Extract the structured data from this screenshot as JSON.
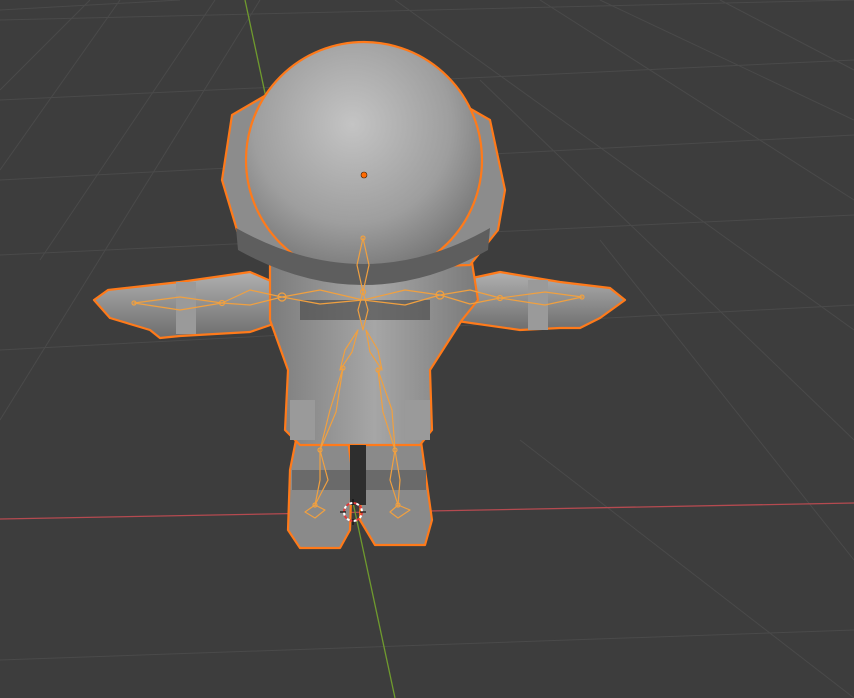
{
  "app": {
    "name": "3D viewport"
  },
  "colors": {
    "background": "#3d3d3d",
    "grid_line": "#4a4a4a",
    "x_axis": "#b54a50",
    "y_axis": "#6f9a2e",
    "selection_outline": "#ff7a1a",
    "armature": "#f0a040",
    "mesh_light": "#b8b8b8",
    "mesh_mid": "#8f8f8f",
    "mesh_dark": "#5e5e5e",
    "origin_dot": "#ff6a00",
    "cursor_red": "#e23a3a",
    "cursor_white": "#ffffff"
  },
  "scene": {
    "objects": [
      {
        "name": "astronaut-mesh",
        "selected": true
      },
      {
        "name": "armature",
        "selected": true
      }
    ],
    "mode": "object"
  }
}
